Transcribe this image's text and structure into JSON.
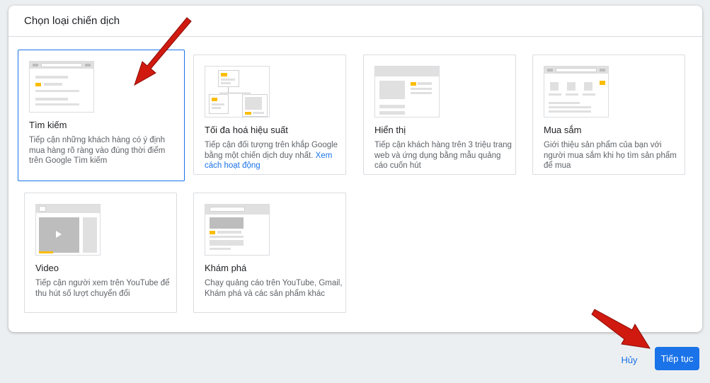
{
  "dialog": {
    "title": "Chọn loại chiến dịch"
  },
  "cards": [
    {
      "id": "search",
      "title": "Tìm kiếm",
      "description": "Tiếp cận những khách hàng có ý định mua hàng rõ ràng vào đúng thời điểm trên Google Tìm kiếm",
      "selected": true
    },
    {
      "id": "performance-max",
      "title": "Tối đa hoá hiệu suất",
      "description": "Tiếp cận đối tượng trên khắp Google bằng một chiến dịch duy nhất.",
      "link": "Xem cách hoạt động"
    },
    {
      "id": "display",
      "title": "Hiển thị",
      "description": "Tiếp cận khách hàng trên 3 triệu trang web và ứng dụng bằng mẫu quảng cáo cuốn hút"
    },
    {
      "id": "shopping",
      "title": "Mua sắm",
      "description": "Giới thiệu sản phẩm của bạn với người mua sắm khi họ tìm sản phẩm để mua"
    },
    {
      "id": "video",
      "title": "Video",
      "description": "Tiếp cận người xem trên YouTube để thu hút số lượt chuyển đổi"
    },
    {
      "id": "discovery",
      "title": "Khám phá",
      "description": "Chạy quảng cáo trên YouTube, Gmail, Khám phá và các sản phẩm khác"
    }
  ],
  "footer": {
    "cancel_label": "Hủy",
    "continue_label": "Tiếp tục"
  },
  "colors": {
    "accent": "#1a73e8",
    "highlight": "#fbbc04",
    "arrow": "#d01a10"
  }
}
